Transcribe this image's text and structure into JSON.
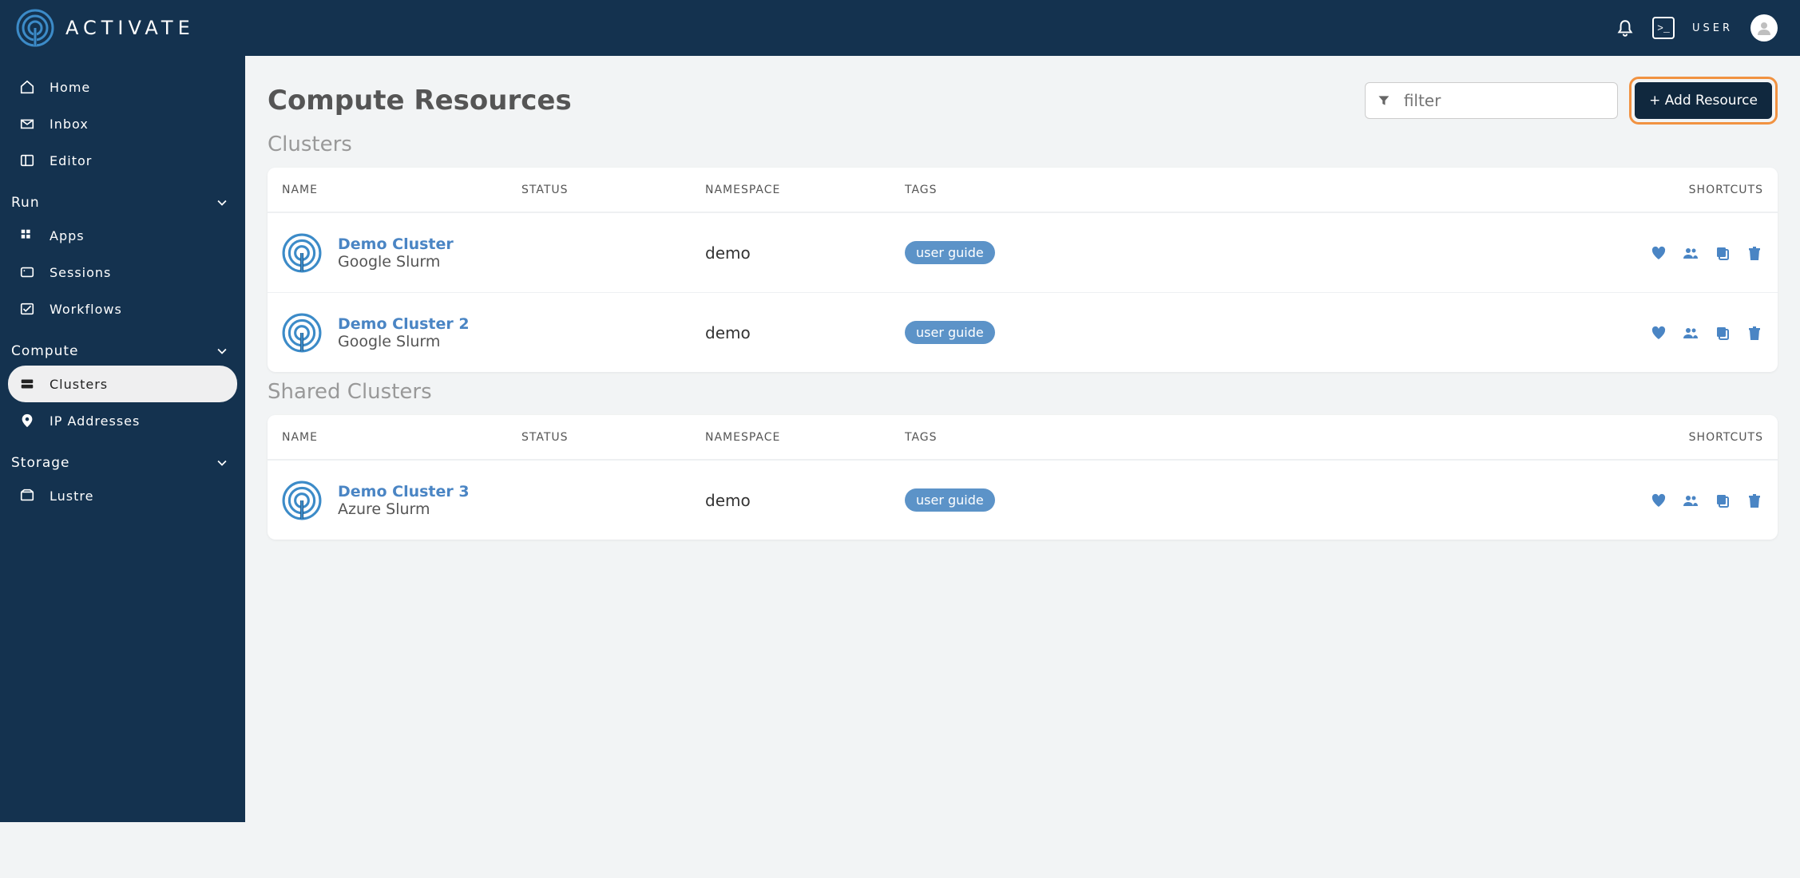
{
  "brand": {
    "word": "ACTIVATE"
  },
  "header": {
    "user_label": "USER"
  },
  "sidebar": {
    "top": [
      {
        "key": "home",
        "label": "Home"
      },
      {
        "key": "inbox",
        "label": "Inbox"
      },
      {
        "key": "editor",
        "label": "Editor"
      }
    ],
    "sections": [
      {
        "title": "Run",
        "items": [
          {
            "key": "apps",
            "label": "Apps"
          },
          {
            "key": "sessions",
            "label": "Sessions"
          },
          {
            "key": "workflows",
            "label": "Workflows"
          }
        ]
      },
      {
        "title": "Compute",
        "items": [
          {
            "key": "clusters",
            "label": "Clusters",
            "active": true
          },
          {
            "key": "ip",
            "label": "IP Addresses"
          }
        ]
      },
      {
        "title": "Storage",
        "items": [
          {
            "key": "lustre",
            "label": "Lustre"
          }
        ]
      }
    ]
  },
  "page": {
    "title": "Compute Resources",
    "filter_placeholder": "filter",
    "add_button": "+ Add Resource"
  },
  "columns": {
    "name": "NAME",
    "status": "STATUS",
    "namespace": "NAMESPACE",
    "tags": "TAGS",
    "shortcuts": "SHORTCUTS"
  },
  "sections": [
    {
      "title": "Clusters",
      "rows": [
        {
          "name": "Demo Cluster",
          "sub": "Google Slurm",
          "namespace": "demo",
          "tag": "user guide"
        },
        {
          "name": "Demo Cluster 2",
          "sub": "Google Slurm",
          "namespace": "demo",
          "tag": "user guide"
        }
      ]
    },
    {
      "title": "Shared Clusters",
      "rows": [
        {
          "name": "Demo Cluster 3",
          "sub": "Azure Slurm",
          "namespace": "demo",
          "tag": "user guide"
        }
      ]
    }
  ]
}
